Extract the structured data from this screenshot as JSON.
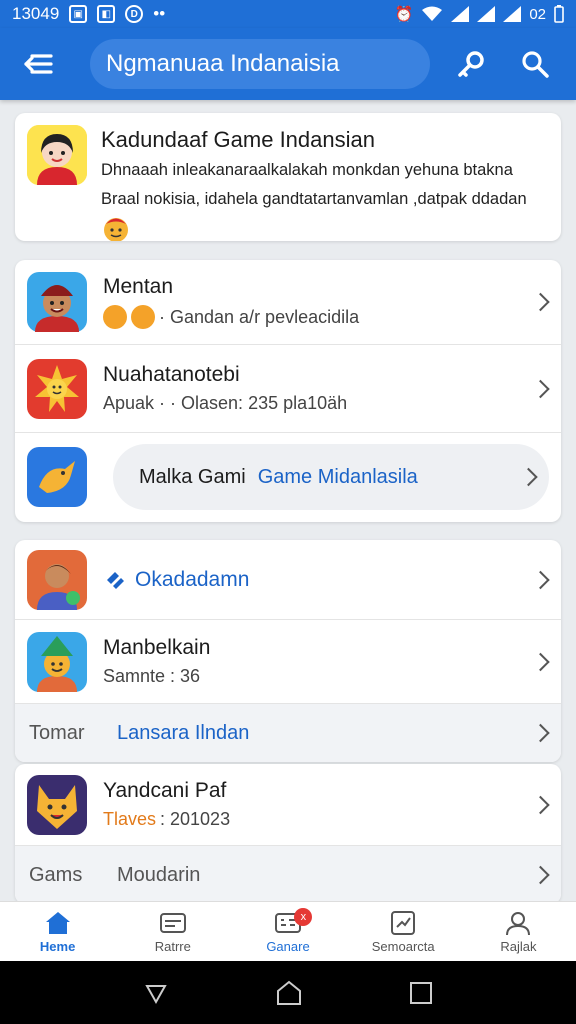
{
  "status": {
    "time": "13049",
    "battery": "02"
  },
  "appbar": {
    "search_text": "Ngmanuaa Indanaisia"
  },
  "hero": {
    "title": "Kadundaaf Game Indansian",
    "desc_line1": "Dhnaaah inleakanaraalkalakah monkdan yehuna btakna",
    "desc_line2": "Braal nokisia, idahela gandtatartanvamlan ,datpak ddadan"
  },
  "group1": {
    "items": [
      {
        "title": "Mentan",
        "subtitle": "· Gandan a/r pevleacidila"
      },
      {
        "title": "Nuahatanotebi",
        "subtitle": "Apuak · · Olasen: 235 pla10äh"
      }
    ],
    "pill": {
      "label": "Malka Gami",
      "link": "Game Midanlasila"
    }
  },
  "group2": {
    "items": [
      {
        "title": "Okadadamn"
      },
      {
        "title": "Manbelkain",
        "subtitle": "Samnte : 36"
      }
    ],
    "section1": {
      "label": "Tomar",
      "link": "Lansara Ilndan"
    }
  },
  "group3": {
    "items": [
      {
        "title": "Yandcani Paf",
        "subtitle_accent": "Tlaves",
        "subtitle": ": 201023"
      }
    ],
    "section2": {
      "label": "Gams",
      "link": "Moudarin"
    }
  },
  "bottom_nav": [
    {
      "label": "Heme",
      "icon": "home-icon",
      "active": true
    },
    {
      "label": "Ratrre",
      "icon": "card-icon"
    },
    {
      "label": "Ganare",
      "icon": "games-icon",
      "badge": "x"
    },
    {
      "label": "Semoarcta",
      "icon": "chart-icon"
    },
    {
      "label": "Rajlak",
      "icon": "profile-icon"
    }
  ],
  "colors": {
    "primary": "#1f6fd6",
    "link": "#1b63c7",
    "accent_orange": "#e27a1a",
    "badge": "#e53935"
  }
}
